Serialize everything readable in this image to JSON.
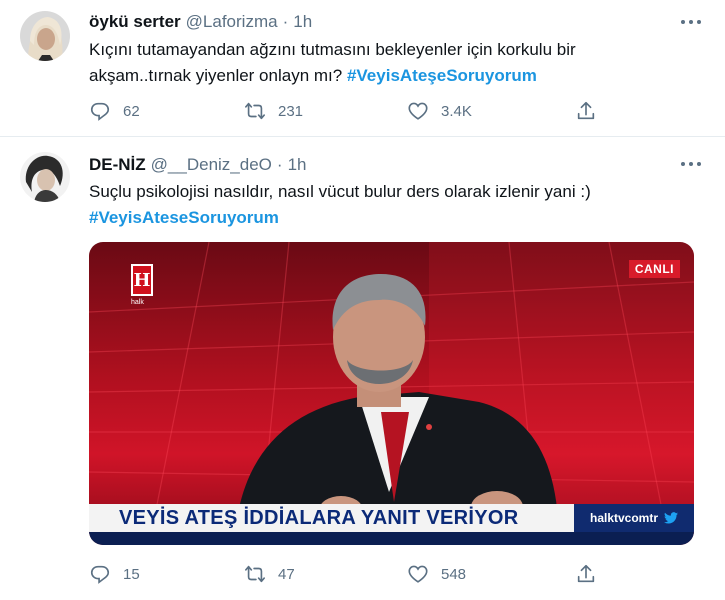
{
  "tweets": [
    {
      "name": "öykü serter",
      "handle": "@Laforizma",
      "dot": "·",
      "time": "1h",
      "text_line1": "Kıçını tutamayandan ağzını tutmasını bekleyenler için korkulu bir",
      "text_line2": "akşam..tırnak yiyenler onlayn mı? ",
      "hashtag": "#VeyisAteşeSoruyorum",
      "replies": "62",
      "retweets": "231",
      "likes": "3.4K"
    },
    {
      "name": "DE-NİZ",
      "handle": "@__Deniz_deO",
      "dot": "·",
      "time": "1h",
      "text_line1": "Suçlu psikolojisi nasıldır, nasıl vücut bulur  ders olarak izlenir yani :)",
      "hashtag": "#VeyisAteseSoruyorum",
      "media": {
        "live_label": "CANLI",
        "ticker": "VEYİS ATEŞ İDDİALARA YANIT VERİYOR",
        "channel": "halktvcomtr",
        "logo_letter": "H",
        "logo_caption": "halk"
      },
      "replies": "15",
      "retweets": "47",
      "likes": "548"
    }
  ],
  "colors": {
    "hashtag": "#1b95e0",
    "muted": "#5b7083",
    "divider": "#e6ecf0"
  },
  "icons": [
    "reply-icon",
    "retweet-icon",
    "like-icon",
    "share-icon",
    "more-icon",
    "twitter-bird-icon"
  ]
}
